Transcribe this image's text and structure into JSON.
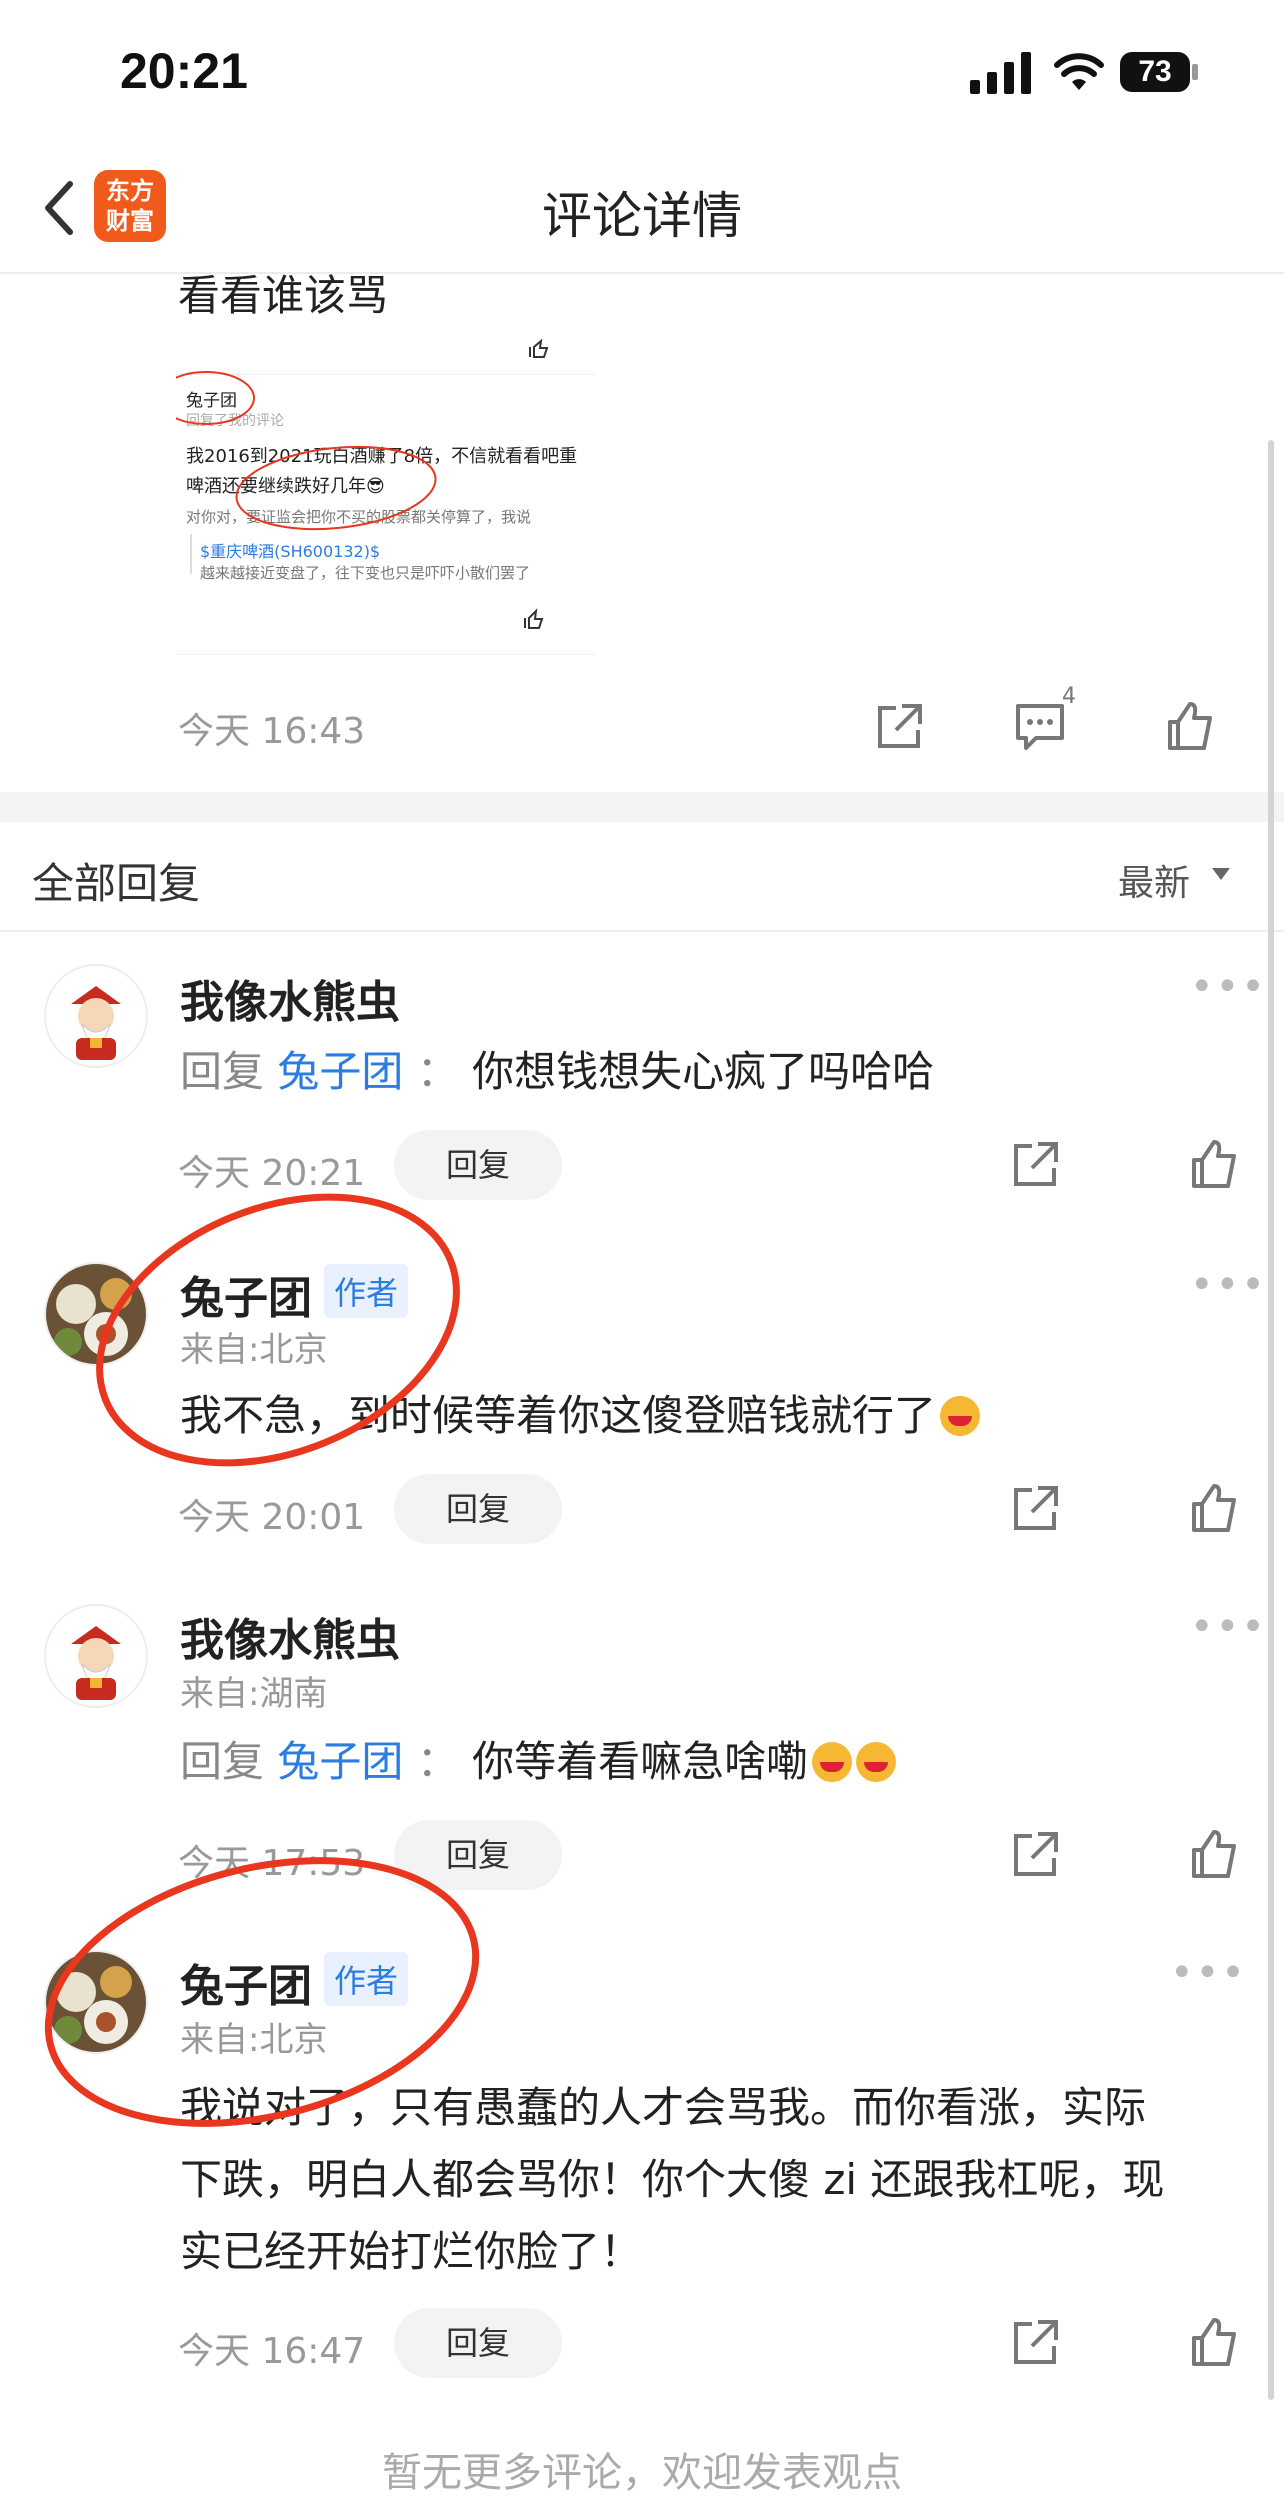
{
  "status_bar": {
    "time": "20:21",
    "battery": "73"
  },
  "header": {
    "title": "评论详情",
    "logo_line1": "东方",
    "logo_line2": "财富"
  },
  "post": {
    "text_partial": "看看谁该骂",
    "time": "今天 16:43",
    "comment_count": "4",
    "embedded_screenshot": {
      "user": "兔子团",
      "sub": "回复了我的评论",
      "line1": "我2016到2021玩白酒赚了8倍，不信就看看吧重",
      "line2": "啤酒还要继续跌好几年😎",
      "line3": "对你对，要证监会把你不买的股票都关停算了，我说",
      "stock": "$重庆啤酒(SH600132)$",
      "line4": "越来越接近变盘了，往下变也只是吓吓小散们罢了"
    }
  },
  "section": {
    "title": "全部回复",
    "sort": "最新"
  },
  "reply_label": "回复",
  "comments": [
    {
      "name": "我像水熊虫",
      "reply_prefix": "回复",
      "mention": "兔子团",
      "sep": "：",
      "text": "你想钱想失心疯了吗哈哈",
      "time": "今天 20:21",
      "button": "回复"
    },
    {
      "name": "兔子团",
      "badge": "作者",
      "location": "来自:北京",
      "text": "我不急，到时候等着你这傻登赔钱就行了",
      "time": "今天 20:01",
      "button": "回复"
    },
    {
      "name": "我像水熊虫",
      "location": "来自:湖南",
      "reply_prefix": "回复",
      "mention": "兔子团",
      "sep": "：",
      "text": "你等着看嘛急啥嘞",
      "time": "今天 17:53",
      "button": "回复"
    },
    {
      "name": "兔子团",
      "badge": "作者",
      "location": "来自:北京",
      "line1": "我说对了，只有愚蠢的人才会骂我。而你看涨，实际",
      "line2": "下跌，明白人都会骂你！你个大傻 zi 还跟我杠呢，现",
      "line3": "实已经开始打烂你脸了！",
      "time": "今天 16:47",
      "button": "回复"
    }
  ],
  "footer_hint": "暂无更多评论，欢迎发表观点",
  "colors": {
    "accent": "#2b7de1",
    "brand": "#f25a1b",
    "annotation_red": "#e8361f"
  },
  "icons": [
    "back-icon",
    "share-icon",
    "comment-icon",
    "like-icon",
    "more-icon"
  ]
}
